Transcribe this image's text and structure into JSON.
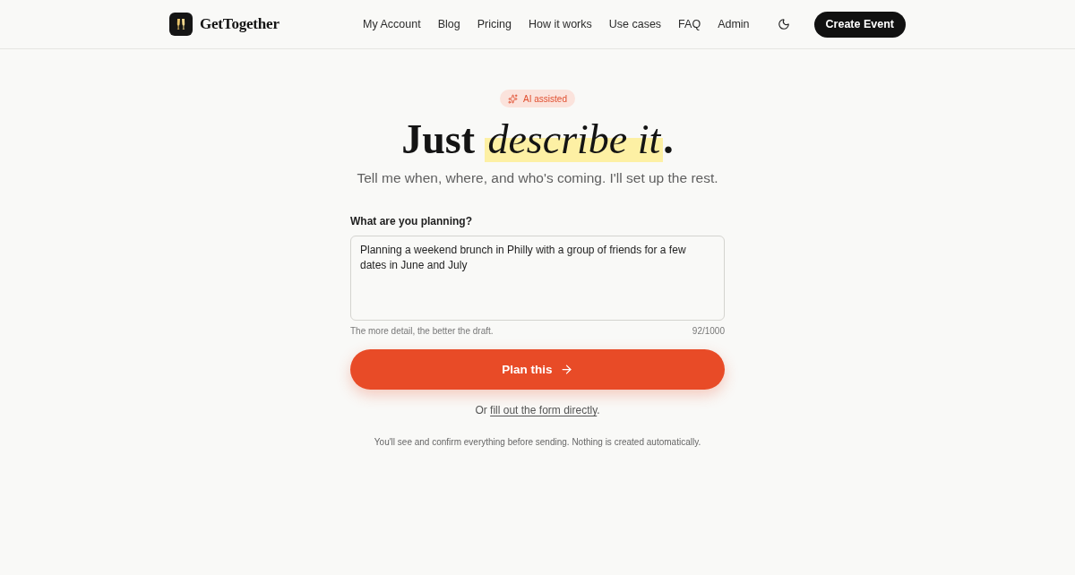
{
  "header": {
    "brand": "GetTogether",
    "nav": [
      "My Account",
      "Blog",
      "Pricing",
      "How it works",
      "Use cases",
      "FAQ",
      "Admin"
    ],
    "create_button": "Create Event"
  },
  "hero": {
    "badge": "AI assisted",
    "heading": {
      "lead": "Just",
      "highlight": "describe it",
      "trail": "."
    },
    "subtitle": "Tell me when, where, and who's coming. I'll set up the rest."
  },
  "form": {
    "label": "What are you planning?",
    "value": "Planning a weekend brunch in Philly with a group of friends for a few dates in June and July",
    "hint": "The more detail, the better the draft.",
    "counter": "92/1000",
    "submit": "Plan this"
  },
  "alternative": {
    "prefix": "Or",
    "link": "fill out the form directly",
    "suffix": "."
  },
  "disclaimer": "You'll see and confirm everything before sending. Nothing is created automatically."
}
